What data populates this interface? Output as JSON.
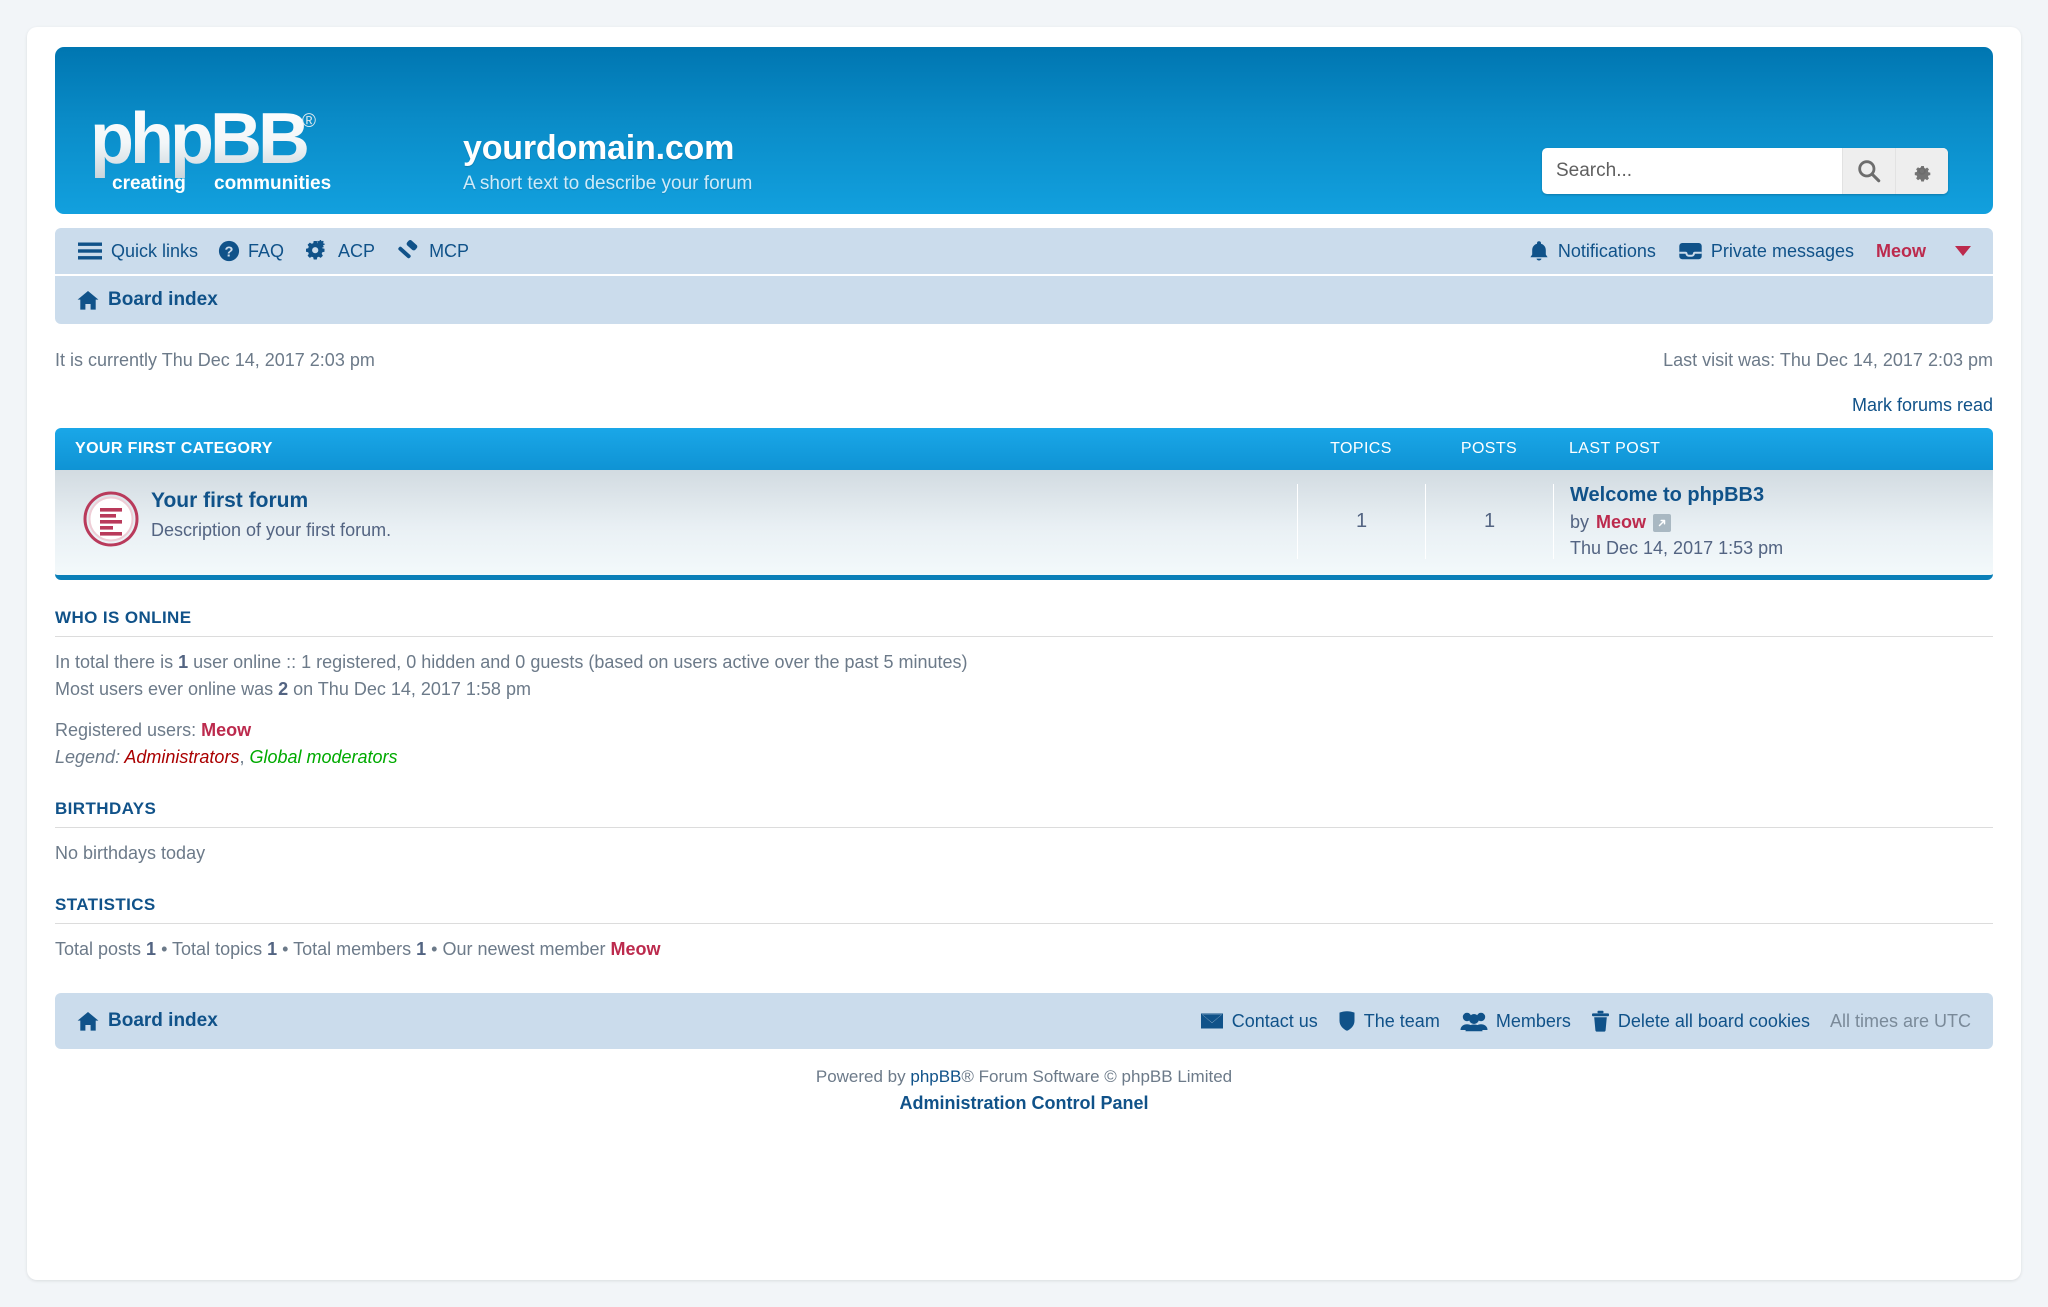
{
  "header": {
    "logo_text_top": "phpBB",
    "logo_reg": "®",
    "logo_sub_left": "creating",
    "logo_sub_right": "communities",
    "site_title": "yourdomain.com",
    "site_description": "A short text to describe your forum",
    "search_placeholder": "Search...",
    "search_value": "",
    "search_icon": "search-icon",
    "search_options_icon": "gear-icon"
  },
  "nav": {
    "left": [
      {
        "label": "Quick links",
        "icon": "hamburger-icon"
      },
      {
        "label": "FAQ",
        "icon": "question-circle-icon"
      },
      {
        "label": "ACP",
        "icon": "gears-icon"
      },
      {
        "label": "MCP",
        "icon": "gavel-icon"
      }
    ],
    "right": [
      {
        "label": "Notifications",
        "icon": "bell-icon"
      },
      {
        "label": "Private messages",
        "icon": "inbox-icon"
      }
    ],
    "username": "Meow",
    "user_caret_icon": "chevron-down-icon",
    "breadcrumb": {
      "label": "Board index",
      "icon": "home-icon"
    }
  },
  "time": {
    "current": "It is currently Thu Dec 14, 2017 2:03 pm",
    "last_visit": "Last visit was: Thu Dec 14, 2017 2:03 pm"
  },
  "actions": {
    "mark_forums_read": "Mark forums read"
  },
  "forum_table": {
    "category": "YOUR FIRST CATEGORY",
    "columns": {
      "topics": "TOPICS",
      "posts": "POSTS",
      "lastpost": "LAST POST"
    },
    "rows": [
      {
        "icon": "forum-unread-icon",
        "name": "Your first forum",
        "description": "Description of your first forum.",
        "topics": "1",
        "posts": "1",
        "last_post_title": "Welcome to phpBB3",
        "last_post_by_prefix": "by",
        "last_post_author": "Meow",
        "last_post_goto_icon": "goto-last-post-icon",
        "last_post_time": "Thu Dec 14, 2017 1:53 pm"
      }
    ]
  },
  "who_is_online": {
    "title": "WHO IS ONLINE",
    "line1_a": "In total there is ",
    "line1_count": "1",
    "line1_b": " user online :: 1 registered, 0 hidden and 0 guests (based on users active over the past 5 minutes)",
    "line2_a": "Most users ever online was ",
    "line2_count": "2",
    "line2_b": " on Thu Dec 14, 2017 1:58 pm",
    "registered_label": "Registered users: ",
    "registered_users": "Meow",
    "legend_label": "Legend: ",
    "legend_admins": "Administrators",
    "legend_sep": ", ",
    "legend_gmods": "Global moderators"
  },
  "birthdays": {
    "title": "BIRTHDAYS",
    "body": "No birthdays today"
  },
  "statistics": {
    "title": "STATISTICS",
    "total_posts_label": "Total posts ",
    "total_posts": "1",
    "sep1": " • ",
    "total_topics_label": "Total topics ",
    "total_topics": "1",
    "sep2": " • ",
    "total_members_label": "Total members ",
    "total_members": "1",
    "sep3": " • ",
    "newest_label": "Our newest member ",
    "newest_member": "Meow"
  },
  "footer_nav": {
    "breadcrumb": {
      "label": "Board index",
      "icon": "home-icon"
    },
    "links": [
      {
        "label": "Contact us",
        "icon": "envelope-icon"
      },
      {
        "label": "The team",
        "icon": "shield-icon"
      },
      {
        "label": "Members",
        "icon": "users-icon"
      },
      {
        "label": "Delete all board cookies",
        "icon": "trash-icon"
      }
    ],
    "timezone": "All times are UTC"
  },
  "copyright": {
    "prefix": "Powered by ",
    "brand": "phpBB",
    "suffix": "® Forum Software © phpBB Limited",
    "acp_link": "Administration Control Panel"
  },
  "colors": {
    "header_blue_top": "#0076b1",
    "header_blue_bottom": "#12a0de",
    "category_blue": "#12a3e5",
    "link_blue": "#105289",
    "nav_bg": "#cbdcec",
    "user_red": "#bc2a4d",
    "admin_red": "#aa0000",
    "gmod_green": "#00aa00",
    "page_bg": "#f2f5f8"
  }
}
